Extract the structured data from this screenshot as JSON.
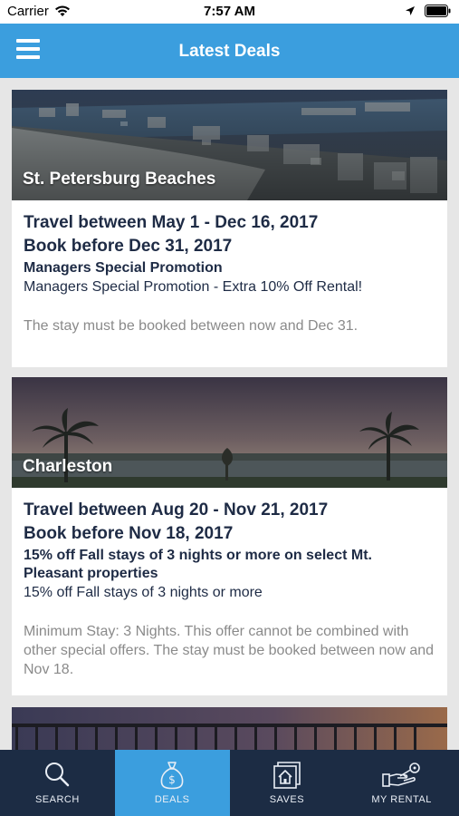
{
  "status_bar": {
    "carrier": "Carrier",
    "time": "7:57 AM"
  },
  "header": {
    "title": "Latest Deals"
  },
  "deals": [
    {
      "place": "St. Petersburg Beaches",
      "travel": "Travel between May 1 - Dec 16, 2017",
      "book_before": "Book before Dec 31, 2017",
      "promo_title": "Managers Special Promotion",
      "promo_desc": "Managers Special Promotion - Extra 10% Off Rental!",
      "terms": "The stay must be booked between now and Dec 31."
    },
    {
      "place": "Charleston",
      "travel": "Travel between Aug 20 - Nov 21, 2017",
      "book_before": "Book before Nov 18, 2017",
      "promo_title": "15% off Fall stays of 3 nights or more on select Mt. Pleasant properties",
      "promo_desc": "15% off Fall stays of 3 nights or more",
      "terms": "Minimum Stay: 3 Nights. This offer cannot be combined with other special offers. The stay must be booked between now and Nov 18."
    }
  ],
  "tabs": [
    {
      "label": "SEARCH",
      "icon": "search-icon"
    },
    {
      "label": "DEALS",
      "icon": "money-bag-icon",
      "active": true
    },
    {
      "label": "SAVES",
      "icon": "saved-homes-icon"
    },
    {
      "label": "MY RENTAL",
      "icon": "hand-key-icon"
    }
  ],
  "colors": {
    "nav_blue": "#3b9ede",
    "tab_bar_navy": "#1c2c44",
    "heading_navy": "#1e2b45",
    "terms_gray": "#8a8a8a"
  }
}
